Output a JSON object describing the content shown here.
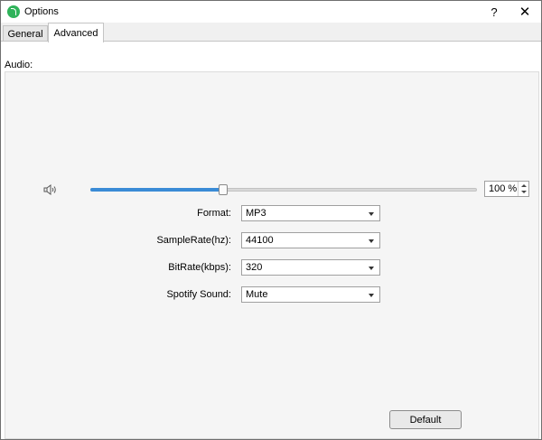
{
  "window": {
    "title": "Options",
    "help_label": "?",
    "close_label": "✕"
  },
  "tabs": [
    {
      "label": "General",
      "active": false
    },
    {
      "label": "Advanced",
      "active": true
    }
  ],
  "audio": {
    "section_label": "Audio:",
    "volume": {
      "percent": 100,
      "display": "100 %",
      "slider_fraction": 0.34
    },
    "rows": [
      {
        "label": "Format:",
        "value": "MP3"
      },
      {
        "label": "SampleRate(hz):",
        "value": "44100"
      },
      {
        "label": "BitRate(kbps):",
        "value": "320"
      },
      {
        "label": "Spotify Sound:",
        "value": "Mute"
      }
    ]
  },
  "buttons": {
    "default_label": "Default"
  },
  "colors": {
    "accent": "#3a8bd6",
    "app_icon": "#2fb35a"
  },
  "icons": {
    "app": "spotify-music-icon",
    "speaker": "speaker-icon"
  }
}
